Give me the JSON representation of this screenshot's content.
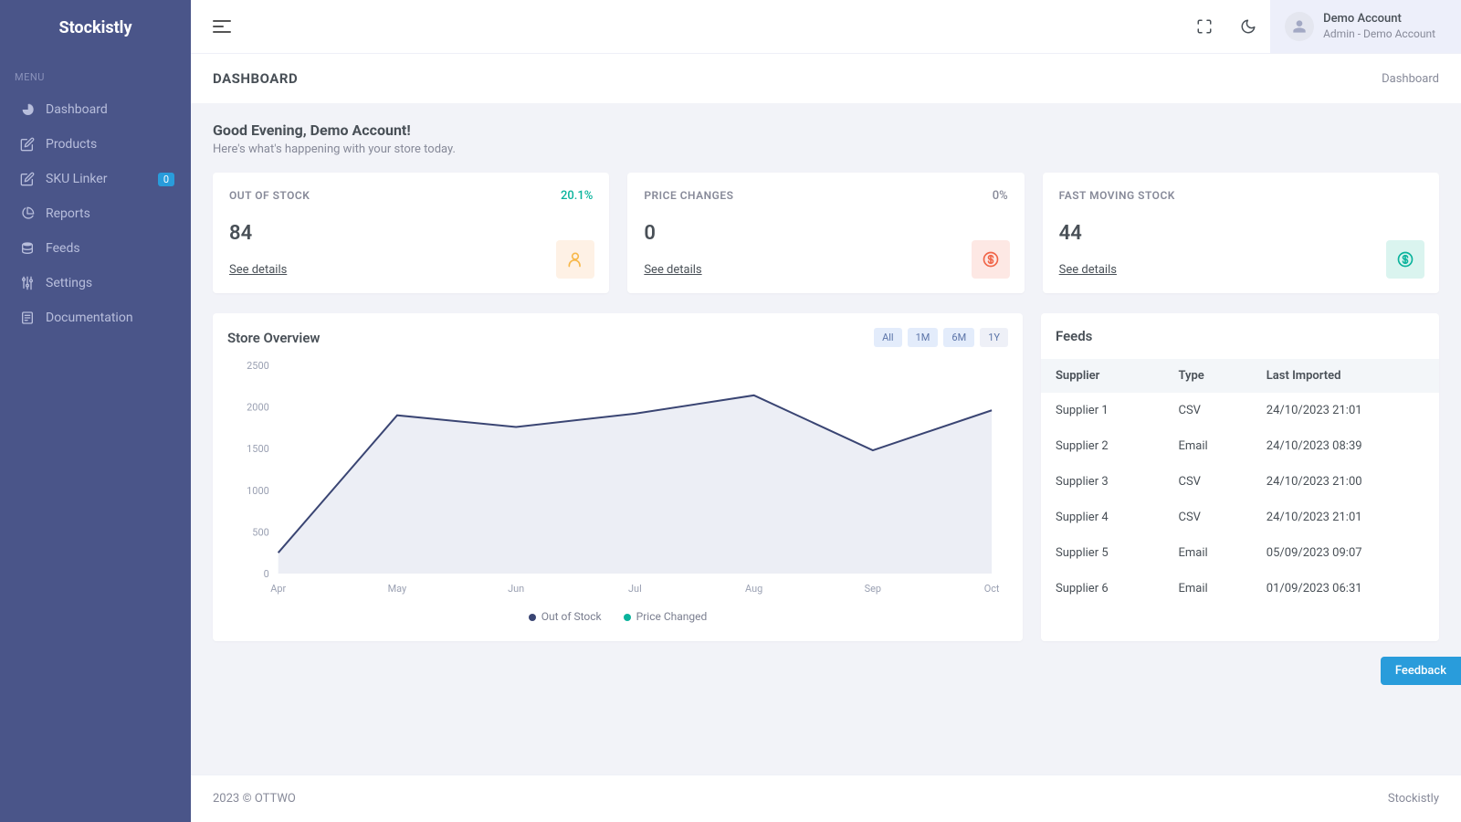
{
  "brand": "Stockistly",
  "sidebar": {
    "menu_label": "MENU",
    "items": [
      {
        "label": "Dashboard",
        "icon": "dashboard-icon",
        "badge": null
      },
      {
        "label": "Products",
        "icon": "products-icon",
        "badge": null
      },
      {
        "label": "SKU Linker",
        "icon": "sku-linker-icon",
        "badge": "0"
      },
      {
        "label": "Reports",
        "icon": "reports-icon",
        "badge": null
      },
      {
        "label": "Feeds",
        "icon": "feeds-icon",
        "badge": null
      },
      {
        "label": "Settings",
        "icon": "settings-icon",
        "badge": null
      },
      {
        "label": "Documentation",
        "icon": "documentation-icon",
        "badge": null
      }
    ]
  },
  "header": {
    "account_name": "Demo Account",
    "account_role": "Admin - Demo Account"
  },
  "page": {
    "title": "DASHBOARD",
    "breadcrumb": "Dashboard"
  },
  "greeting": {
    "title": "Good Evening, Demo Account!",
    "subtitle": "Here's what's happening with your store today."
  },
  "stats": [
    {
      "label": "OUT OF STOCK",
      "pct": "20.1%",
      "pct_class": "pct-green",
      "value": "84",
      "link": "See details",
      "icon_class": "icon-amber",
      "icon": "user"
    },
    {
      "label": "PRICE CHANGES",
      "pct": "0%",
      "pct_class": "pct-gray",
      "value": "0",
      "link": "See details",
      "icon_class": "icon-red",
      "icon": "dollar"
    },
    {
      "label": "FAST MOVING STOCK",
      "pct": "",
      "pct_class": "",
      "value": "44",
      "link": "See details",
      "icon_class": "icon-green",
      "icon": "dollar"
    }
  ],
  "chart": {
    "title": "Store Overview",
    "tabs": [
      "All",
      "1M",
      "6M",
      "1Y"
    ],
    "legend": [
      {
        "label": "Out of Stock",
        "color": "#3a4573"
      },
      {
        "label": "Price Changed",
        "color": "#0ab39c"
      }
    ]
  },
  "chart_data": {
    "type": "area",
    "categories": [
      "Apr",
      "May",
      "Jun",
      "Jul",
      "Aug",
      "Sep",
      "Oct"
    ],
    "series": [
      {
        "name": "Out of Stock",
        "color": "#3a4573",
        "values": [
          250,
          1900,
          1760,
          1920,
          2140,
          1480,
          1960
        ]
      }
    ],
    "y_ticks": [
      0,
      500,
      1000,
      1500,
      2000,
      2500
    ],
    "ylim": [
      0,
      2500
    ],
    "xlabel": "",
    "ylabel": ""
  },
  "feeds": {
    "title": "Feeds",
    "columns": [
      "Supplier",
      "Type",
      "Last Imported"
    ],
    "rows": [
      {
        "supplier": "Supplier 1",
        "type": "CSV",
        "time": "24/10/2023 21:01",
        "tclass": "ts-green"
      },
      {
        "supplier": "Supplier 2",
        "type": "Email",
        "time": "24/10/2023 08:39",
        "tclass": "ts-green"
      },
      {
        "supplier": "Supplier 3",
        "type": "CSV",
        "time": "24/10/2023 21:00",
        "tclass": "ts-green"
      },
      {
        "supplier": "Supplier 4",
        "type": "CSV",
        "time": "24/10/2023 21:01",
        "tclass": "ts-green"
      },
      {
        "supplier": "Supplier 5",
        "type": "Email",
        "time": "05/09/2023 09:07",
        "tclass": "ts-red"
      },
      {
        "supplier": "Supplier 6",
        "type": "Email",
        "time": "01/09/2023 06:31",
        "tclass": "ts-red"
      }
    ]
  },
  "footer": {
    "left": "2023 © OTTWO",
    "right": "Stockistly"
  },
  "feedback": "Feedback"
}
